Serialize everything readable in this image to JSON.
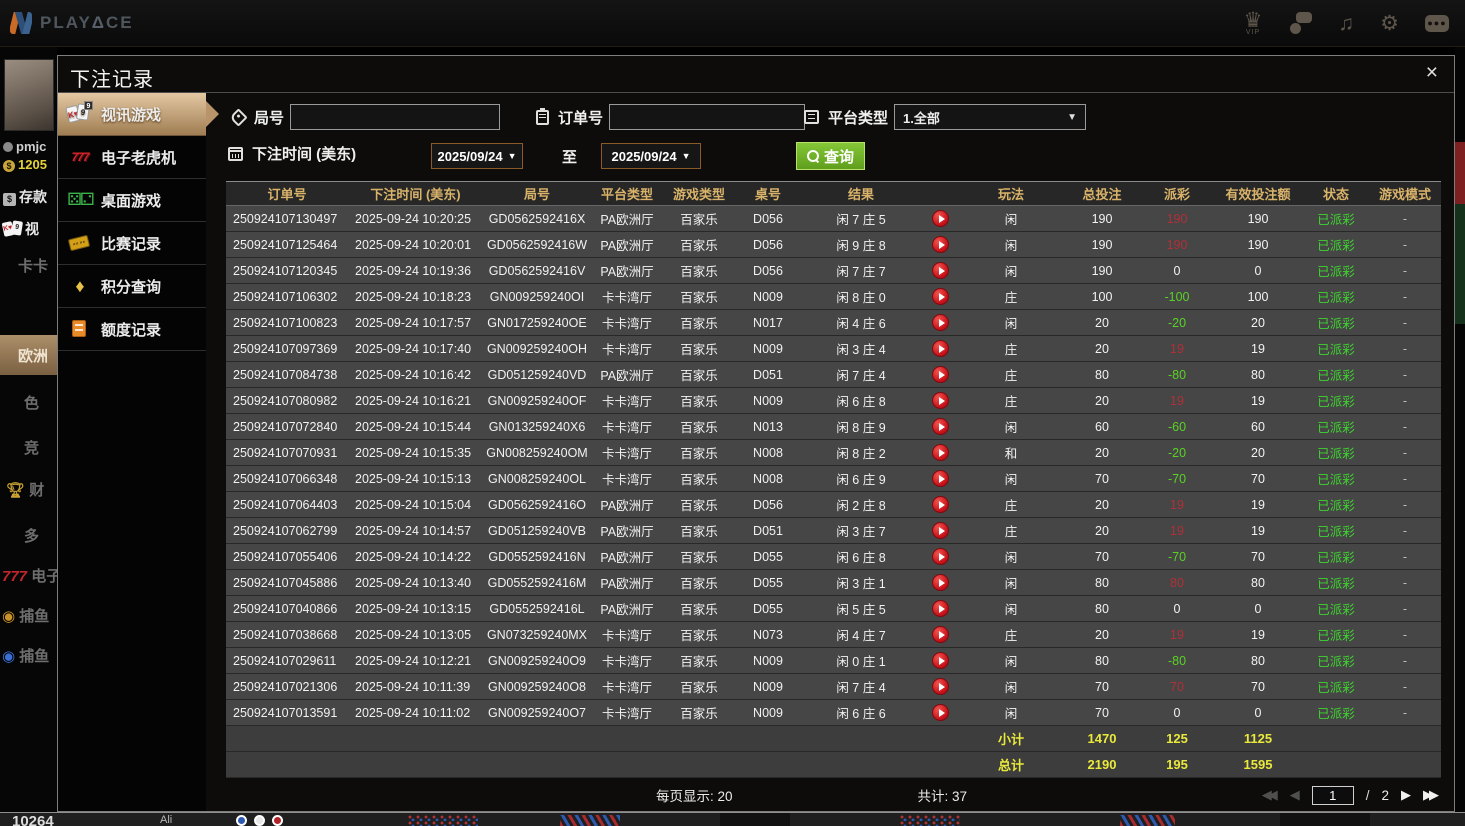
{
  "topbar": {
    "brand_play": "PLAY",
    "brand_tri": "Δ",
    "brand_ce": "CE",
    "vip_label": "VIP"
  },
  "background": {
    "username": "pmjc",
    "balance": "1205",
    "deposit_label": "存款",
    "video_label": "视",
    "nav": [
      "卡卡",
      "欧洲",
      "色",
      "竞",
      "财",
      "多",
      "电子",
      "捕鱼",
      "捕鱼"
    ],
    "bottom_value": "10264",
    "bottom_dealer": "Ali"
  },
  "modal": {
    "title": "下注记录",
    "close_glyph": "×",
    "menu": [
      {
        "label": "视讯游戏"
      },
      {
        "label": "电子老虎机"
      },
      {
        "label": "桌面游戏"
      },
      {
        "label": "比赛记录"
      },
      {
        "label": "积分查询"
      },
      {
        "label": "额度记录"
      }
    ],
    "filters": {
      "round_label": "局号",
      "round_value": "",
      "order_label": "订单号",
      "order_value": "",
      "platform_label": "平台类型",
      "platform_value": "1.全部",
      "time_label": "下注时间 (美东)",
      "date_from": "2025/09/24",
      "to_label": "至",
      "date_to": "2025/09/24",
      "search_label": "查询"
    },
    "table": {
      "headers": [
        "订单号",
        "下注时间 (美东)",
        "局号",
        "平台类型",
        "游戏类型",
        "桌号",
        "结果",
        "",
        "玩法",
        "总投注",
        "派彩",
        "有效投注额",
        "状态",
        "游戏模式"
      ],
      "rows": [
        [
          "250924107130497",
          "2025-09-24 10:20:25",
          "GD0562592416X",
          "PA欧洲厅",
          "百家乐",
          "D056",
          "闲 7 庄 5",
          "闲",
          "190",
          "190",
          "190",
          "已派彩",
          "-"
        ],
        [
          "250924107125464",
          "2025-09-24 10:20:01",
          "GD0562592416W",
          "PA欧洲厅",
          "百家乐",
          "D056",
          "闲 9 庄 8",
          "闲",
          "190",
          "190",
          "190",
          "已派彩",
          "-"
        ],
        [
          "250924107120345",
          "2025-09-24 10:19:36",
          "GD0562592416V",
          "PA欧洲厅",
          "百家乐",
          "D056",
          "闲 7 庄 7",
          "闲",
          "190",
          "0",
          "0",
          "已派彩",
          "-"
        ],
        [
          "250924107106302",
          "2025-09-24 10:18:23",
          "GN009259240OI",
          "卡卡湾厅",
          "百家乐",
          "N009",
          "闲 8 庄 0",
          "庄",
          "100",
          "-100",
          "100",
          "已派彩",
          "-"
        ],
        [
          "250924107100823",
          "2025-09-24 10:17:57",
          "GN017259240OE",
          "卡卡湾厅",
          "百家乐",
          "N017",
          "闲 4 庄 6",
          "闲",
          "20",
          "-20",
          "20",
          "已派彩",
          "-"
        ],
        [
          "250924107097369",
          "2025-09-24 10:17:40",
          "GN009259240OH",
          "卡卡湾厅",
          "百家乐",
          "N009",
          "闲 3 庄 4",
          "庄",
          "20",
          "19",
          "19",
          "已派彩",
          "-"
        ],
        [
          "250924107084738",
          "2025-09-24 10:16:42",
          "GD051259240VD",
          "PA欧洲厅",
          "百家乐",
          "D051",
          "闲 7 庄 4",
          "庄",
          "80",
          "-80",
          "80",
          "已派彩",
          "-"
        ],
        [
          "250924107080982",
          "2025-09-24 10:16:21",
          "GN009259240OF",
          "卡卡湾厅",
          "百家乐",
          "N009",
          "闲 6 庄 8",
          "庄",
          "20",
          "19",
          "19",
          "已派彩",
          "-"
        ],
        [
          "250924107072840",
          "2025-09-24 10:15:44",
          "GN013259240X6",
          "卡卡湾厅",
          "百家乐",
          "N013",
          "闲 8 庄 9",
          "闲",
          "60",
          "-60",
          "60",
          "已派彩",
          "-"
        ],
        [
          "250924107070931",
          "2025-09-24 10:15:35",
          "GN008259240OM",
          "卡卡湾厅",
          "百家乐",
          "N008",
          "闲 8 庄 2",
          "和",
          "20",
          "-20",
          "20",
          "已派彩",
          "-"
        ],
        [
          "250924107066348",
          "2025-09-24 10:15:13",
          "GN008259240OL",
          "卡卡湾厅",
          "百家乐",
          "N008",
          "闲 6 庄 9",
          "闲",
          "70",
          "-70",
          "70",
          "已派彩",
          "-"
        ],
        [
          "250924107064403",
          "2025-09-24 10:15:04",
          "GD0562592416O",
          "PA欧洲厅",
          "百家乐",
          "D056",
          "闲 2 庄 8",
          "庄",
          "20",
          "19",
          "19",
          "已派彩",
          "-"
        ],
        [
          "250924107062799",
          "2025-09-24 10:14:57",
          "GD051259240VB",
          "PA欧洲厅",
          "百家乐",
          "D051",
          "闲 3 庄 7",
          "庄",
          "20",
          "19",
          "19",
          "已派彩",
          "-"
        ],
        [
          "250924107055406",
          "2025-09-24 10:14:22",
          "GD0552592416N",
          "PA欧洲厅",
          "百家乐",
          "D055",
          "闲 6 庄 8",
          "闲",
          "70",
          "-70",
          "70",
          "已派彩",
          "-"
        ],
        [
          "250924107045886",
          "2025-09-24 10:13:40",
          "GD0552592416M",
          "PA欧洲厅",
          "百家乐",
          "D055",
          "闲 3 庄 1",
          "闲",
          "80",
          "80",
          "80",
          "已派彩",
          "-"
        ],
        [
          "250924107040866",
          "2025-09-24 10:13:15",
          "GD0552592416L",
          "PA欧洲厅",
          "百家乐",
          "D055",
          "闲 5 庄 5",
          "闲",
          "80",
          "0",
          "0",
          "已派彩",
          "-"
        ],
        [
          "250924107038668",
          "2025-09-24 10:13:05",
          "GN073259240MX",
          "卡卡湾厅",
          "百家乐",
          "N073",
          "闲 4 庄 7",
          "庄",
          "20",
          "19",
          "19",
          "已派彩",
          "-"
        ],
        [
          "250924107029611",
          "2025-09-24 10:12:21",
          "GN009259240O9",
          "卡卡湾厅",
          "百家乐",
          "N009",
          "闲 0 庄 1",
          "闲",
          "80",
          "-80",
          "80",
          "已派彩",
          "-"
        ],
        [
          "250924107021306",
          "2025-09-24 10:11:39",
          "GN009259240O8",
          "卡卡湾厅",
          "百家乐",
          "N009",
          "闲 7 庄 4",
          "闲",
          "70",
          "70",
          "70",
          "已派彩",
          "-"
        ],
        [
          "250924107013591",
          "2025-09-24 10:11:02",
          "GN009259240O7",
          "卡卡湾厅",
          "百家乐",
          "N009",
          "闲 6 庄 6",
          "闲",
          "70",
          "0",
          "0",
          "已派彩",
          "-"
        ]
      ],
      "subtotal": {
        "label": "小计",
        "total": "1470",
        "payout": "125",
        "valid": "1125"
      },
      "grand_total": {
        "label": "总计",
        "total": "2190",
        "payout": "195",
        "valid": "1595"
      }
    },
    "pagination": {
      "per_page_label": "每页显示: 20",
      "total_label": "共计: 37",
      "page": "1",
      "page_sep": "/",
      "total_pages": "2"
    }
  },
  "colors": {
    "header_gold": "#d9b36a",
    "win_red": "#b03038",
    "loss_green": "#5ad225",
    "status_green": "#3fd42f",
    "summary_yellow": "#e9e93c",
    "active_tan": "#c9a87c",
    "search_green": "#6fae28"
  }
}
